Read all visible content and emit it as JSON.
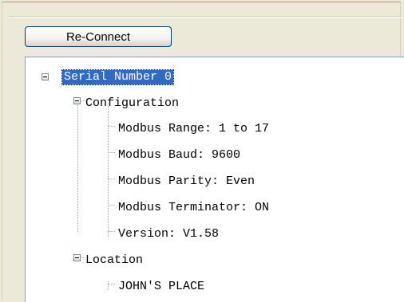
{
  "toolbar": {
    "reconnect_label": "Re-Connect"
  },
  "tree": {
    "root": "Serial Number 0",
    "configuration": {
      "label": "Configuration",
      "items": [
        "Modbus Range: 1 to 17",
        "Modbus Baud: 9600",
        "Modbus Parity: Even",
        "Modbus Terminator: ON",
        "Version: V1.58"
      ]
    },
    "location": {
      "label": "Location",
      "items": [
        "JOHN'S PLACE"
      ]
    }
  },
  "colors": {
    "selection": "#316ac5",
    "window_bg": "#ece9d8",
    "tree_bg": "#ffffff"
  }
}
